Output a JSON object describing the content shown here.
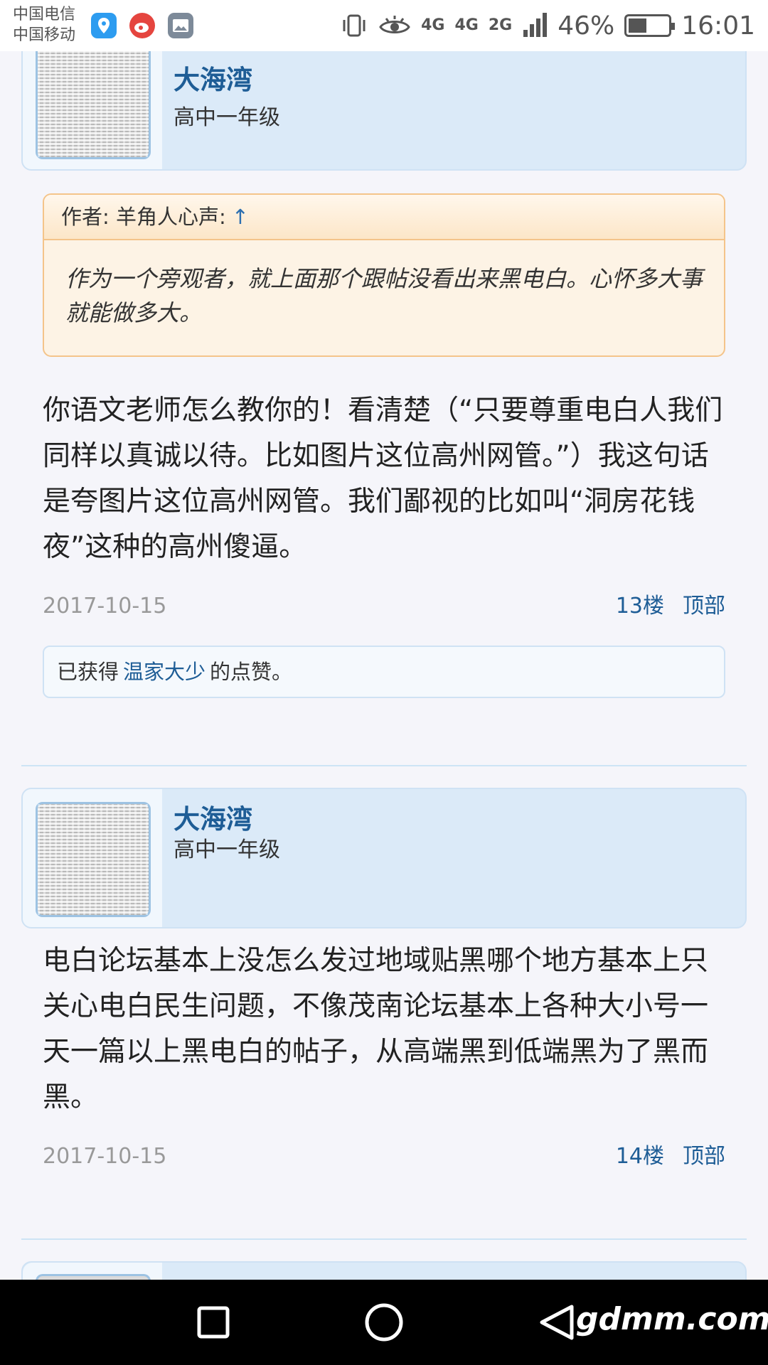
{
  "status_bar": {
    "carrier_1": "中国电信",
    "carrier_2": "中国移动",
    "network_1": "4G",
    "network_2": "4G",
    "network_3": "2G",
    "network_4": "2G",
    "battery_percent": "46%",
    "battery_level": 0.46,
    "time": "16:01"
  },
  "posts": [
    {
      "user": {
        "name": "大海湾",
        "grade": "高中一年级"
      },
      "quote": {
        "header": "作者: 羊角人心声:",
        "arrow": "↑",
        "body": "作为一个旁观者，就上面那个跟帖没看出来黑电白。心怀多大事就能做多大。"
      },
      "text": "你语文老师怎么教你的！看清楚（“只要尊重电白人我们同样以真诚以待。比如图片这位高州网管。”）我这句话是夸图片这位高州网管。我们鄙视的比如叫“洞房花钱夜”这种的高州傻逼。",
      "date": "2017-10-15",
      "floor": "13楼",
      "top_link": "顶部",
      "like": {
        "prefix": "已获得",
        "user": "温家大少",
        "suffix": "的点赞。"
      }
    },
    {
      "user": {
        "name": "大海湾",
        "grade": "高中一年级"
      },
      "text": "电白论坛基本上没怎么发过地域贴黑哪个地方基本上只关心电白民生问题，不像茂南论坛基本上各种大小号一天一篇以上黑电白的帖子，从高端黑到低端黑为了黑而黑。",
      "date": "2017-10-15",
      "floor": "14楼",
      "top_link": "顶部"
    }
  ],
  "watermark": "gdmm.com",
  "colors": {
    "accent_blue": "#1e5d96",
    "card_blue": "#dbeaf8",
    "quote_bg": "#fdf3e5",
    "quote_border": "#f4c48a",
    "page_bg": "#f5f5fa"
  },
  "icons": {
    "maps_app": "location-pin-icon",
    "weibo_app": "weibo-icon",
    "gallery_app": "gallery-icon",
    "vibrate": "vibrate-icon",
    "eye_comfort": "eye-icon",
    "signal": "signal-icon",
    "battery": "battery-icon",
    "nav_recent": "square-icon",
    "nav_home": "circle-icon",
    "nav_back": "triangle-back-icon"
  }
}
